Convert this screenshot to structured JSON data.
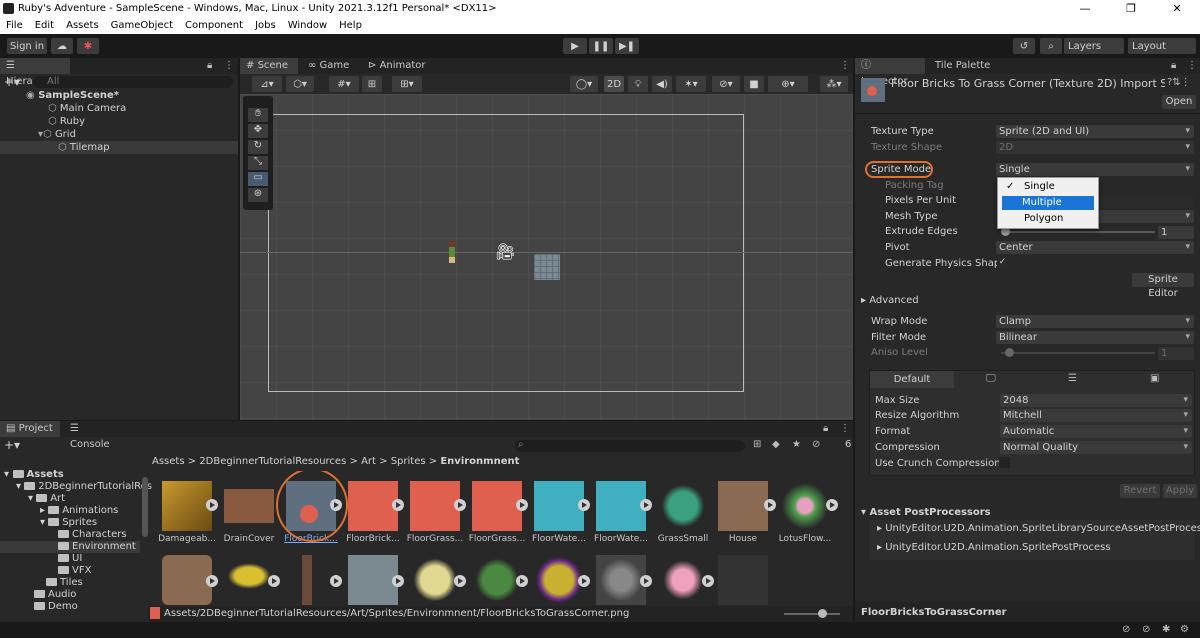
{
  "window": {
    "title": "Ruby's Adventure - SampleScene - Windows, Mac, Linux - Unity 2021.3.12f1 Personal* <DX11>"
  },
  "menu": [
    "File",
    "Edit",
    "Assets",
    "GameObject",
    "Component",
    "Jobs",
    "Window",
    "Help"
  ],
  "toolbar": {
    "sign_in": "Sign in",
    "layers": "Layers",
    "layout": "Layout"
  },
  "hierarchy": {
    "tab": "Hierarchy",
    "search_placeholder": "All",
    "items": [
      {
        "label": "SampleScene*"
      },
      {
        "label": "Main Camera"
      },
      {
        "label": "Ruby"
      },
      {
        "label": "Grid"
      },
      {
        "label": "Tilemap"
      }
    ]
  },
  "scene_tabs": {
    "scene": "Scene",
    "game": "Game",
    "animator": "Animator",
    "mode_2d": "2D"
  },
  "inspector": {
    "tab": "Inspector",
    "tab2": "Tile Palette",
    "header_title": "Floor Bricks To Grass Corner (Texture 2D) Import Setti",
    "open_button": "Open",
    "texture_type": {
      "label": "Texture Type",
      "value": "Sprite (2D and UI)"
    },
    "texture_shape": {
      "label": "Texture Shape",
      "value": "2D"
    },
    "sprite_mode": {
      "label": "Sprite Mode",
      "value": "Single"
    },
    "packing_tag": {
      "label": "Packing Tag"
    },
    "pixels_per_unit": {
      "label": "Pixels Per Unit"
    },
    "mesh_type": {
      "label": "Mesh Type"
    },
    "extrude_edges": {
      "label": "Extrude Edges",
      "value": "1"
    },
    "pivot": {
      "label": "Pivot",
      "value": "Center"
    },
    "generate_physics": {
      "label": "Generate Physics Shape",
      "checked": "✓"
    },
    "sprite_editor": "Sprite Editor",
    "advanced": "Advanced",
    "wrap_mode": {
      "label": "Wrap Mode",
      "value": "Clamp"
    },
    "filter_mode": {
      "label": "Filter Mode",
      "value": "Bilinear"
    },
    "aniso_level": {
      "label": "Aniso Level",
      "value": "1"
    },
    "platform_tab": "Default",
    "max_size": {
      "label": "Max Size",
      "value": "2048"
    },
    "resize_algorithm": {
      "label": "Resize Algorithm",
      "value": "Mitchell"
    },
    "format": {
      "label": "Format",
      "value": "Automatic"
    },
    "compression": {
      "label": "Compression",
      "value": "Normal Quality"
    },
    "crunch": {
      "label": "Use Crunch Compression"
    },
    "revert": "Revert",
    "apply": "Apply",
    "postprocessors_title": "Asset PostProcessors",
    "postprocessors": [
      "UnityEditor.U2D.Animation.SpriteLibrarySourceAssetPostProcessor",
      "UnityEditor.U2D.Animation.SpritePostProcess"
    ],
    "footer_name": "FloorBricksToGrassCorner",
    "dropdown_options": [
      {
        "label": "Single",
        "check": "✓"
      },
      {
        "label": "Multiple"
      },
      {
        "label": "Polygon"
      }
    ]
  },
  "project": {
    "tab": "Project",
    "tab2": "Console",
    "count": "6",
    "breadcrumb": [
      "Assets",
      "2DBeginnerTutorialResources",
      "Art",
      "Sprites",
      "Environmnent"
    ],
    "breadcrumb_sep": ">",
    "tree": [
      {
        "label": "Assets",
        "indent": 0
      },
      {
        "label": "2DBeginnerTutorialRes",
        "indent": 1
      },
      {
        "label": "Art",
        "indent": 2
      },
      {
        "label": "Animations",
        "indent": 3
      },
      {
        "label": "Sprites",
        "indent": 3
      },
      {
        "label": "Characters",
        "indent": 4
      },
      {
        "label": "Environment",
        "indent": 4
      },
      {
        "label": "UI",
        "indent": 4
      },
      {
        "label": "VFX",
        "indent": 4
      },
      {
        "label": "Tiles",
        "indent": 3
      },
      {
        "label": "Audio",
        "indent": 2
      },
      {
        "label": "Demo",
        "indent": 2
      }
    ],
    "assets": [
      {
        "label": "Damageab...",
        "color": "#c89a30"
      },
      {
        "label": "DrainCover",
        "color": "#8a5a40"
      },
      {
        "label": "FloorBrick...",
        "color": "#5f6f80"
      },
      {
        "label": "FloorBrick...",
        "color": "#e06050"
      },
      {
        "label": "FloorGrass...",
        "color": "#e06050"
      },
      {
        "label": "FloorGrass...",
        "color": "#e06050"
      },
      {
        "label": "FloorWate...",
        "color": "#40b0c0"
      },
      {
        "label": "FloorWate...",
        "color": "#40b0c0"
      },
      {
        "label": "GrassSmall",
        "color": "#3aa080"
      },
      {
        "label": "House",
        "color": "#8a6a50"
      },
      {
        "label": "LotusFlow...",
        "color": "#50a050"
      }
    ],
    "path": "Assets/2DBeginnerTutorialResources/Art/Sprites/Environmnent/FloorBricksToGrassCorner.png"
  }
}
